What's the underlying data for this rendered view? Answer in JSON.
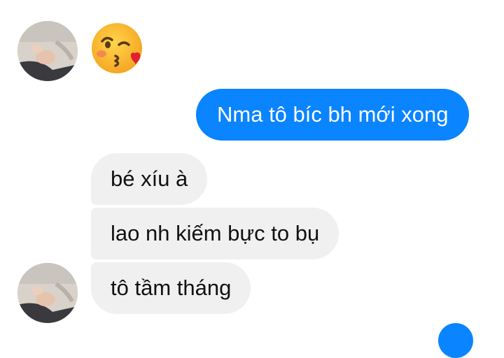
{
  "messages": [
    {
      "direction": "incoming",
      "type": "emoji",
      "emoji_name": "face-blowing-kiss-emoji"
    },
    {
      "direction": "outgoing",
      "type": "text",
      "text": "Nma tô bíc bh mới xong"
    },
    {
      "direction": "incoming",
      "type": "text",
      "text": "bé xíu à"
    },
    {
      "direction": "incoming",
      "type": "text",
      "text": "lao nh kiếm bực to bụ"
    },
    {
      "direction": "incoming",
      "type": "text",
      "text": "tô tầm tháng"
    }
  ],
  "colors": {
    "outgoing_bubble": "#0a84ff",
    "incoming_bubble": "#f0f0f0",
    "outgoing_text": "#ffffff",
    "incoming_text": "#111111"
  }
}
